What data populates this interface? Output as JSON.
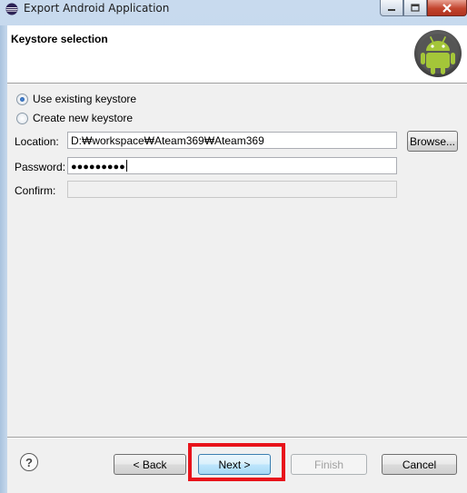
{
  "window": {
    "title": "Export Android Application",
    "controls": {
      "minimize": "minimize",
      "maximize": "maximize",
      "close": "close"
    }
  },
  "header": {
    "title": "Keystore selection",
    "logo_icon": "android-robot-icon"
  },
  "options": [
    {
      "label": "Use existing keystore",
      "checked": true
    },
    {
      "label": "Create new keystore",
      "checked": false
    }
  ],
  "fields": {
    "location": {
      "label": "Location:",
      "value": "D:₩workspace₩Ateam369₩Ateam369"
    },
    "password": {
      "label": "Password:",
      "value": "●●●●●●●●●"
    },
    "confirm": {
      "label": "Confirm:",
      "value": ""
    }
  },
  "buttons": {
    "browse": "Browse...",
    "back": "< Back",
    "next": "Next >",
    "finish": "Finish",
    "cancel": "Cancel"
  },
  "help_icon": "help-question-icon",
  "colors": {
    "highlight": "#e8131b",
    "android_green": "#97c024"
  }
}
